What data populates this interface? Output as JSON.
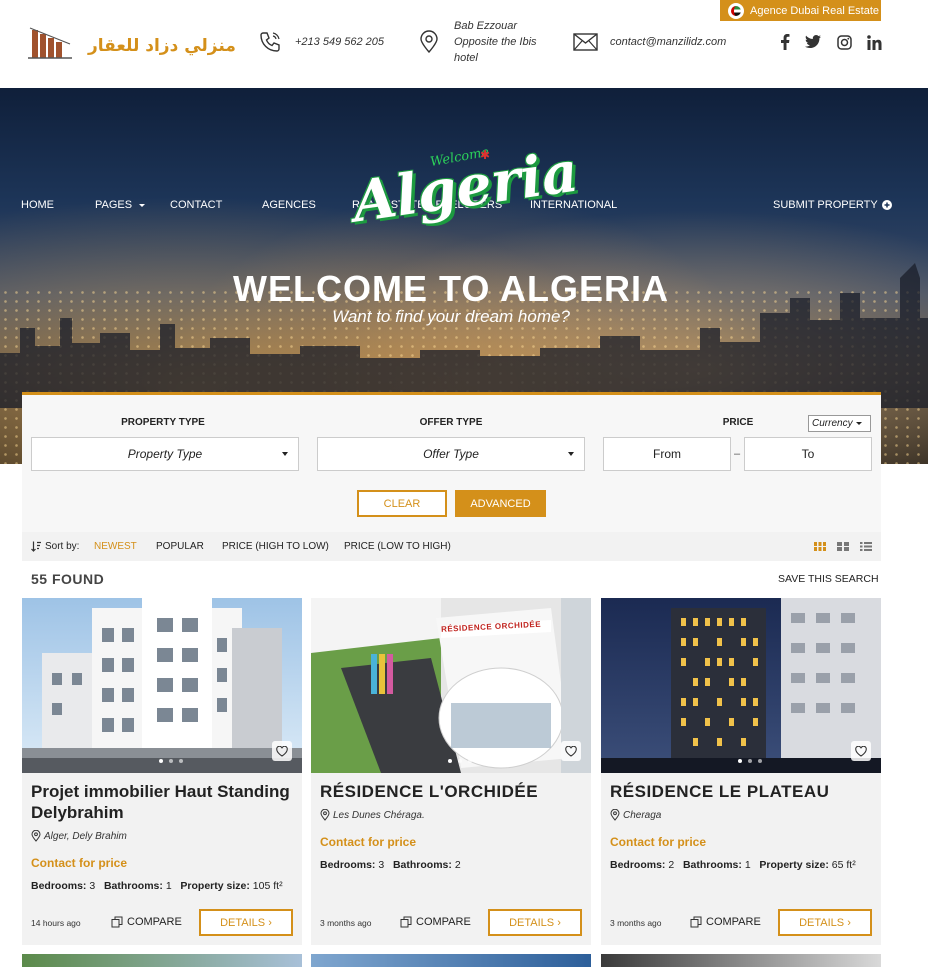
{
  "header": {
    "logo_text": "منزلي دزاد للعقار",
    "phone": "+213 549 562 205",
    "address_lines": [
      "Bab Ezzouar",
      "Opposite the Ibis",
      "hotel"
    ],
    "email": "contact@manzilidz.com",
    "agency_button": "Agence Dubai Real Estate",
    "social": [
      "facebook-icon",
      "twitter-icon",
      "instagram-icon",
      "linkedin-icon"
    ],
    "social_labels": [
      "f",
      "t",
      "ig",
      "in"
    ]
  },
  "nav": {
    "items": [
      "HOME",
      "PAGES",
      "CONTACT",
      "AGENCES",
      "REAL ESTATE DEVELOPERS",
      "INTERNATIONAL"
    ],
    "submit": "SUBMIT PROPERTY"
  },
  "hero": {
    "script_small": "Welcome",
    "script_big": "Algeria",
    "title": "WELCOME TO ALGERIA",
    "subtitle": "Want to find your dream home?"
  },
  "search": {
    "property_type_label": "PROPERTY TYPE",
    "property_type_value": "Property Type",
    "offer_type_label": "OFFER TYPE",
    "offer_type_value": "Offer Type",
    "price_label": "PRICE",
    "currency": "Currency",
    "price_from": "From",
    "price_sep": "–",
    "price_to": "To",
    "clear": "CLEAR",
    "advanced": "ADVANCED"
  },
  "sort": {
    "label": "Sort by:",
    "options": [
      "NEWEST",
      "POPULAR",
      "PRICE (HIGH TO LOW)",
      "PRICE (LOW TO HIGH)"
    ],
    "active": "NEWEST"
  },
  "results": {
    "found": "55 FOUND",
    "save_search": "SAVE THIS SEARCH"
  },
  "colors": {
    "accent": "#d4901a"
  },
  "cards": [
    {
      "title": "Projet immobilier Haut Standing Delybrahim",
      "location": "Alger, Dely Brahim",
      "price": "Contact for price",
      "bedrooms_label": "Bedrooms:",
      "bedrooms": "3",
      "bathrooms_label": "Bathrooms:",
      "bathrooms": "1",
      "size_label": "Property size:",
      "size": "105 ft²",
      "ago": "14 hours ago",
      "compare": "COMPARE",
      "details": "DETAILS ›"
    },
    {
      "title": "RÉSIDENCE L'ORCHIDÉE",
      "location": "Les Dunes Chéraga.",
      "price": "Contact for price",
      "bedrooms_label": "Bedrooms:",
      "bedrooms": "3",
      "bathrooms_label": "Bathrooms:",
      "bathrooms": "2",
      "ago": "3 months ago",
      "compare": "COMPARE",
      "details": "DETAILS ›",
      "sign": "RÉSIDENCE ORCHIDÉE"
    },
    {
      "title": "RÉSIDENCE LE PLATEAU",
      "location": "Cheraga",
      "price": "Contact for price",
      "bedrooms_label": "Bedrooms:",
      "bedrooms": "2",
      "bathrooms_label": "Bathrooms:",
      "bathrooms": "1",
      "size_label": "Property size:",
      "size": "65 ft²",
      "ago": "3 months ago",
      "compare": "COMPARE",
      "details": "DETAILS ›"
    }
  ]
}
